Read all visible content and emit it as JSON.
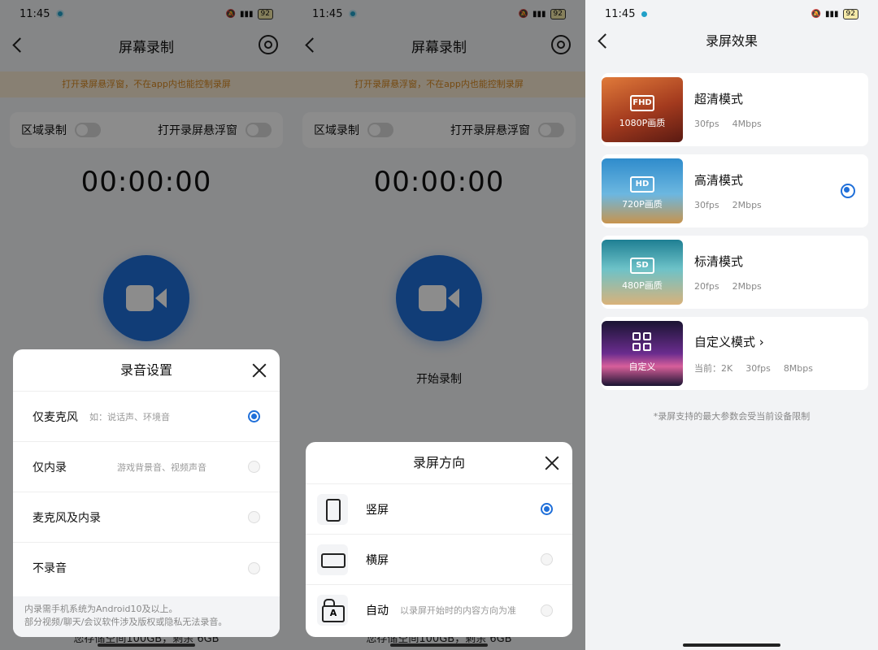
{
  "status": {
    "time": "11:45",
    "battery": "92"
  },
  "screen": {
    "title": "屏幕录制",
    "tip": "打开录屏悬浮窗，不在app内也能控制录屏",
    "region_label": "区域录制",
    "float_label": "打开录屏悬浮窗",
    "timer": "00:00:00",
    "start_label": "开始录制",
    "storage": "您存储空间100GB，剩余 6GB"
  },
  "audio_sheet": {
    "title": "录音设置",
    "options": [
      {
        "label": "仅麦克风",
        "hint": "如：说话声、环境音",
        "selected": true
      },
      {
        "label": "仅内录",
        "hint": "游戏背景音、视频声音",
        "selected": false
      },
      {
        "label": "麦克风及内录",
        "hint": "",
        "selected": false
      },
      {
        "label": "不录音",
        "hint": "",
        "selected": false
      }
    ],
    "note1": "内录需手机系统为Android10及以上。",
    "note2": "部分视频/聊天/会议软件涉及版权或隐私无法录音。"
  },
  "orient_sheet": {
    "title": "录屏方向",
    "options": [
      {
        "label": "竖屏",
        "hint": "",
        "selected": true
      },
      {
        "label": "横屏",
        "hint": "",
        "selected": false
      },
      {
        "label": "自动",
        "hint": "以录屏开始时的内容方向为准",
        "selected": false
      }
    ]
  },
  "quality": {
    "title": "录屏效果",
    "cards": [
      {
        "badge": "FHD",
        "quality": "1080P画质",
        "name": "超清模式",
        "fps": "30fps",
        "rate": "4Mbps",
        "selected": false,
        "bg": "#b8552e"
      },
      {
        "badge": "HD",
        "quality": "720P画质",
        "name": "高清模式",
        "fps": "30fps",
        "rate": "2Mbps",
        "selected": true,
        "bg": "#4da3d6"
      },
      {
        "badge": "SD",
        "quality": "480P画质",
        "name": "标清模式",
        "fps": "20fps",
        "rate": "2Mbps",
        "selected": false,
        "bg": "#3a9aa6"
      }
    ],
    "custom": {
      "label": "自定义",
      "name": "自定义模式",
      "prefix": "当前：2K",
      "fps": "30fps",
      "rate": "8Mbps"
    },
    "footnote": "*录屏支持的最大参数会受当前设备限制"
  }
}
